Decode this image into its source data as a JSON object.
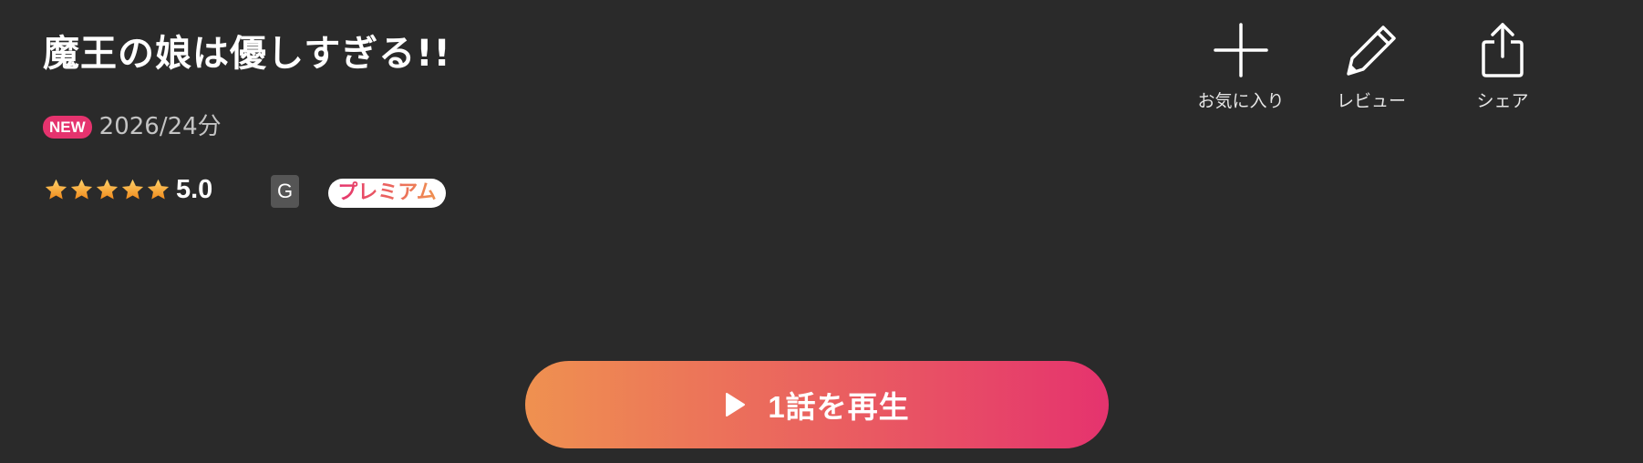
{
  "title": "魔王の娘は優しすぎる!!",
  "meta": {
    "new_badge": "NEW",
    "info": "2026/24分"
  },
  "rating": {
    "value": "5.0",
    "stars": 5,
    "max_stars": 5,
    "star_icon": "star-icon"
  },
  "age_rating": "G",
  "premium_label": "プレミアム",
  "actions": {
    "favorite": {
      "label": "お気に入り",
      "icon": "plus-icon"
    },
    "review": {
      "label": "レビュー",
      "icon": "pencil-icon"
    },
    "share": {
      "label": "シェア",
      "icon": "share-icon"
    }
  },
  "play": {
    "label": "1話を再生",
    "icon": "play-icon"
  },
  "colors": {
    "background": "#2a2a2a",
    "accent_pink": "#e5336e",
    "accent_orange": "#ef9150",
    "star": "#f5a623",
    "age_badge": "#555555"
  }
}
